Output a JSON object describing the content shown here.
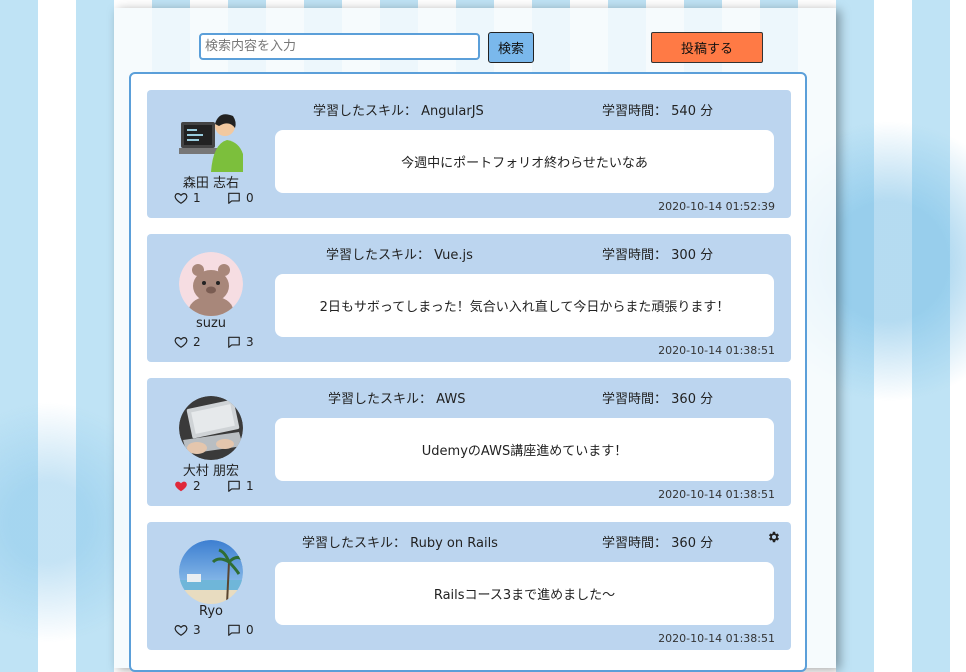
{
  "search": {
    "placeholder": "検索内容を入力",
    "button_label": "検索"
  },
  "post_button_label": "投稿する",
  "skill_prefix": "学習したスキル：",
  "hours_prefix": "学習時間：",
  "hours_unit": "分",
  "posts": [
    {
      "username": "森田 志右",
      "skill": "AngularJS",
      "hours": "540",
      "message": "今週中にポートフォリオ終わらせたいなあ",
      "likes": "1",
      "liked": false,
      "comments": "0",
      "timestamp": "2020-10-14 01:52:39",
      "avatar_icon": "programmer-avatar",
      "has_settings": false
    },
    {
      "username": "suzu",
      "skill": "Vue.js",
      "hours": "300",
      "message": "2日もサボってしまった！気合い入れ直して今日からまた頑張ります！",
      "likes": "2",
      "liked": false,
      "comments": "3",
      "timestamp": "2020-10-14 01:38:51",
      "avatar_icon": "bear-avatar",
      "has_settings": false
    },
    {
      "username": "大村 朋宏",
      "skill": "AWS",
      "hours": "360",
      "message": "UdemyのAWS講座進めています！",
      "likes": "2",
      "liked": true,
      "comments": "1",
      "timestamp": "2020-10-14 01:38:51",
      "avatar_icon": "laptop-photo-avatar",
      "has_settings": false
    },
    {
      "username": "Ryo",
      "skill": "Ruby on Rails",
      "hours": "360",
      "message": "Railsコース3まで進めました〜",
      "likes": "3",
      "liked": false,
      "comments": "0",
      "timestamp": "2020-10-14 01:38:51",
      "avatar_icon": "beach-photo-avatar",
      "has_settings": true
    }
  ],
  "colors": {
    "card_bg": "#bcd5ef",
    "accent_blue": "#5b9fd9",
    "post_button": "#ff7a45",
    "liked_heart": "#e0283a"
  }
}
